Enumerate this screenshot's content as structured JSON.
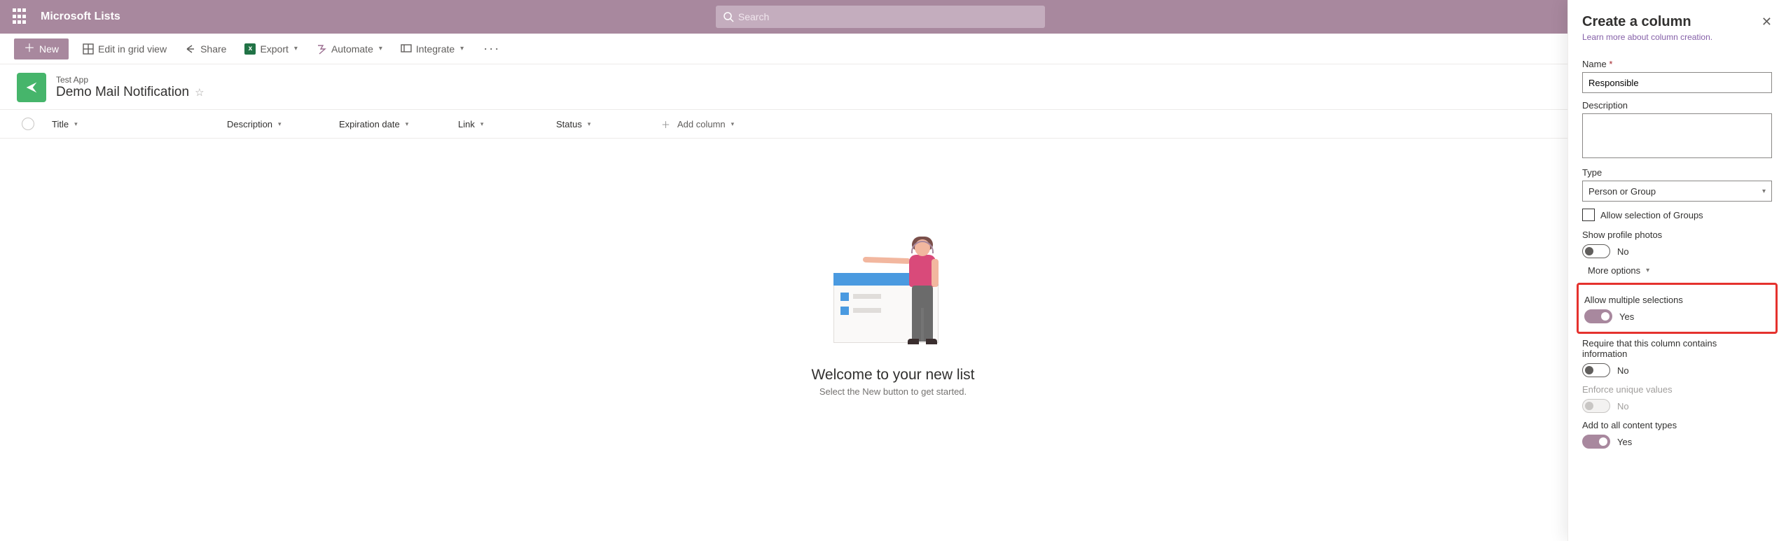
{
  "topbar": {
    "app_title": "Microsoft Lists",
    "search_placeholder": "Search"
  },
  "cmdbar": {
    "new": "New",
    "edit_grid": "Edit in grid view",
    "share": "Share",
    "export": "Export",
    "automate": "Automate",
    "integrate": "Integrate"
  },
  "list": {
    "app_hint": "Test App",
    "title": "Demo Mail Notification"
  },
  "columns": {
    "title": "Title",
    "description": "Description",
    "expiration_date": "Expiration date",
    "link": "Link",
    "status": "Status",
    "add": "Add column"
  },
  "empty": {
    "heading": "Welcome to your new list",
    "sub": "Select the New button to get started."
  },
  "panel": {
    "title": "Create a column",
    "learn_more": "Learn more about column creation.",
    "name_label": "Name",
    "name_value": "Responsible",
    "description_label": "Description",
    "description_value": "",
    "type_label": "Type",
    "type_value": "Person or Group",
    "allow_groups_label": "Allow selection of Groups",
    "show_photos_label": "Show profile photos",
    "show_photos_state": "No",
    "more_options": "More options",
    "allow_multi_label": "Allow multiple selections",
    "allow_multi_state": "Yes",
    "require_label_line1": "Require that this column contains",
    "require_label_line2": "information",
    "require_state": "No",
    "enforce_unique_label": "Enforce unique values",
    "enforce_unique_state": "No",
    "add_content_types_label": "Add to all content types",
    "add_content_types_state": "Yes"
  }
}
